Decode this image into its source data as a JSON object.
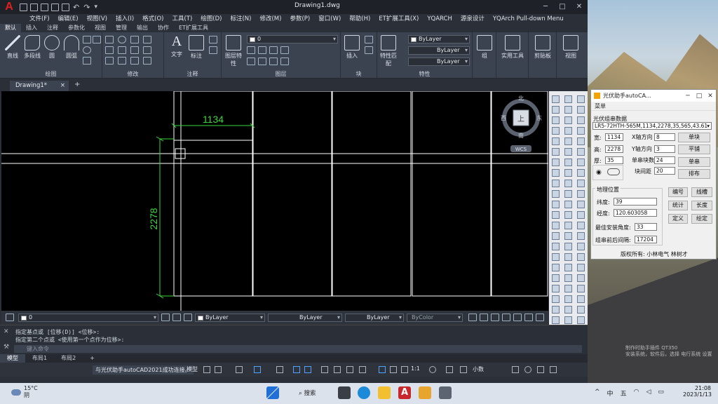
{
  "window": {
    "title": "Drawing1.dwg",
    "app_logo": "A",
    "icons": [
      "autocad-logo-icon",
      "new-icon",
      "open-icon",
      "save-icon",
      "saveas-icon",
      "print-icon",
      "undo-icon",
      "redo-icon",
      "share-icon",
      "search-icon",
      "user-icon",
      "cart-icon",
      "help-icon",
      "minimize-icon",
      "maximize-icon",
      "close-icon"
    ]
  },
  "menubar": [
    "文件(F)",
    "编辑(E)",
    "视图(V)",
    "插入(I)",
    "格式(O)",
    "工具(T)",
    "绘图(D)",
    "标注(N)",
    "修改(M)",
    "参数(P)",
    "窗口(W)",
    "帮助(H)",
    "ET扩展工具(X)",
    "YQARCH",
    "源泉设计",
    "YQArch Pull-down Menu"
  ],
  "ribbon_tabs": [
    "默认",
    "插入",
    "注释",
    "参数化",
    "视图",
    "管理",
    "输出",
    "协作",
    "ET扩展工具"
  ],
  "ribbon": {
    "draw": {
      "title": "绘图",
      "tools": [
        "直线",
        "多段线",
        "圆",
        "圆弧"
      ]
    },
    "modify": {
      "title": "修改"
    },
    "annotation": {
      "title": "注释",
      "tools": [
        "文字",
        "标注"
      ]
    },
    "layers": {
      "title": "图层",
      "tools": [
        "图层特性"
      ],
      "current_layer": "0"
    },
    "block": {
      "title": "块",
      "tools": [
        "插入"
      ]
    },
    "properties": {
      "title": "特性",
      "tools": [
        "特性匹配"
      ],
      "color": "ByLayer",
      "linetype": "ByLayer",
      "lineweight": "ByLayer"
    },
    "group": {
      "tools": [
        "组",
        "实用工具",
        "剪贴板",
        "视图"
      ]
    }
  },
  "doc_tabs": {
    "active": "Drawing1*",
    "close": "×",
    "plus": "+"
  },
  "drawing": {
    "dim_horizontal": "1134",
    "dim_vertical": "2278",
    "bg": "#000000",
    "line_color": "#ffffff",
    "dim_color": "#3dd63d"
  },
  "viewcube": {
    "north": "北",
    "south": "南",
    "east": "东",
    "west": "西",
    "face": "上",
    "wcs": "WCS"
  },
  "canvas_toolbar": {
    "layer": "0",
    "color": "ByLayer",
    "linetype": "ByLayer",
    "lineweight": "ByLayer",
    "plotstyle": "ByColor"
  },
  "command_line": {
    "history": [
      "指定基点或 [位移(D)] <位移>:",
      "指定第二个点或 <使用第一个点作为位移>:"
    ],
    "placeholder": "键入命令"
  },
  "layout_tabs": [
    "模型",
    "布局1",
    "布局2"
  ],
  "status_bar": {
    "message": "与光伏助手autoCAD2021成功连接。",
    "model": "模型",
    "scale": "1:1",
    "units": "小数"
  },
  "dialog": {
    "title": "光伏助手autoCA...",
    "menu": "菜单",
    "group1_title": "光伏组串数据",
    "module": "LR5-72HTH-565M,1134,2278,35,565,43.61",
    "width_label": "宽:",
    "width": "1134",
    "height_label": "高:",
    "height": "2278",
    "thick_label": "厚:",
    "thick": "35",
    "x_dir_label": "X轴方向",
    "x_dir": "8",
    "y_dir_label": "Y轴方向",
    "y_dir": "3",
    "blocks_label": "单串块数",
    "blocks": "24",
    "gap_label": "块间距",
    "gap": "20",
    "buttons_top": [
      "单块",
      "平铺",
      "单串",
      "排布"
    ],
    "group2_title": "地理位置",
    "lat_label": "纬度:",
    "lat": "39",
    "lon_label": "经度:",
    "lon": "120.603058",
    "angle_label": "最佳安装角度:",
    "angle": "33",
    "spacing_label": "组串前后间隔:",
    "spacing": "17204",
    "buttons_bottom": [
      "编号",
      "线槽",
      "统计",
      "长度",
      "定义",
      "绘定"
    ],
    "footer": "版权所有: 小林电气 林树才"
  },
  "taskbar": {
    "weather_temp": "15°C",
    "weather_desc": "阴",
    "search": "搜索",
    "time": "21:08",
    "date": "2023/1/13",
    "tray": [
      "^",
      "中",
      "五"
    ]
  },
  "watermark": {
    "line1": "制作时助手插件 QT350",
    "line2": "安装系统，软件后，选择 电行系统 设置"
  }
}
